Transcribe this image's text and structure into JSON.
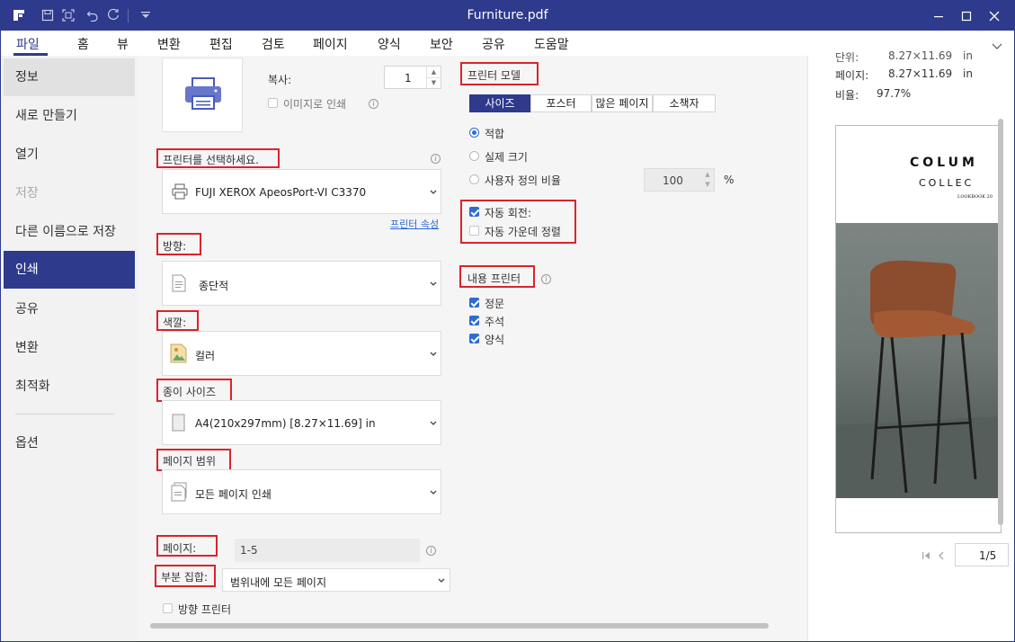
{
  "window": {
    "title": "Furniture.pdf"
  },
  "menu": {
    "items": [
      "파일",
      "홈",
      "뷰",
      "변환",
      "편집",
      "검토",
      "페이지",
      "양식",
      "보안",
      "공유",
      "도움말"
    ]
  },
  "sidebar": {
    "items": [
      "정보",
      "새로 만들기",
      "열기",
      "저장",
      "다른 이름으로 저장",
      "인쇄",
      "공유",
      "변환",
      "최적화",
      "옵션"
    ]
  },
  "print": {
    "copies_label": "복사:",
    "copies_value": "1",
    "print_as_image": "이미지로 인쇄",
    "select_printer_label": "프린터를 선택하세요.",
    "printer_name": "FUJI XEROX ApeosPort-VI C3370",
    "printer_properties": "프린터 속성",
    "orientation_label": "방향:",
    "orientation_value": "종단적",
    "color_label": "색깔:",
    "color_value": "컬러",
    "paper_size_label": "종이 사이즈",
    "paper_size_value": "A4(210x297mm) [8.27×11.69] in",
    "page_range_label": "페이지 범위",
    "page_range_value": "모든 페이지 인쇄",
    "pages_label": "페이지:",
    "pages_value": "1-5",
    "subset_label": "부분 집합:",
    "subset_value": "범위내에 모든 페이지",
    "reverse_printer": "방향 프린터"
  },
  "printer_model": {
    "label": "프린터 모델",
    "tabs": [
      "사이즈",
      "포스터",
      "많은 페이지",
      "소책자"
    ],
    "fit": "적합",
    "actual_size": "실제 크기",
    "custom_scale": "사용자 정의 비율",
    "custom_scale_value": "100",
    "percent": "%",
    "auto_rotate": "자동 회전:",
    "auto_center": "자동 가운데 정렬"
  },
  "content_printer": {
    "label": "내용 프린터",
    "items": [
      "정문",
      "주석",
      "양식"
    ]
  },
  "preview": {
    "cut_label": "단위:",
    "cut_value": "8.27×11.69",
    "cut_unit": "in",
    "page_label": "페이지:",
    "page_size": "8.27×11.69",
    "page_unit": "in",
    "ratio_label": "비율:",
    "ratio_value": "97.7%",
    "page_title_1": "COLUM",
    "page_title_2": "COLLEC",
    "page_small": "LOOKBOOK 20",
    "page_nav": "1/5"
  },
  "colors": {
    "accent": "#2e3a8c",
    "highlight": "#d9242c",
    "checkbox": "#2e6bd6"
  }
}
